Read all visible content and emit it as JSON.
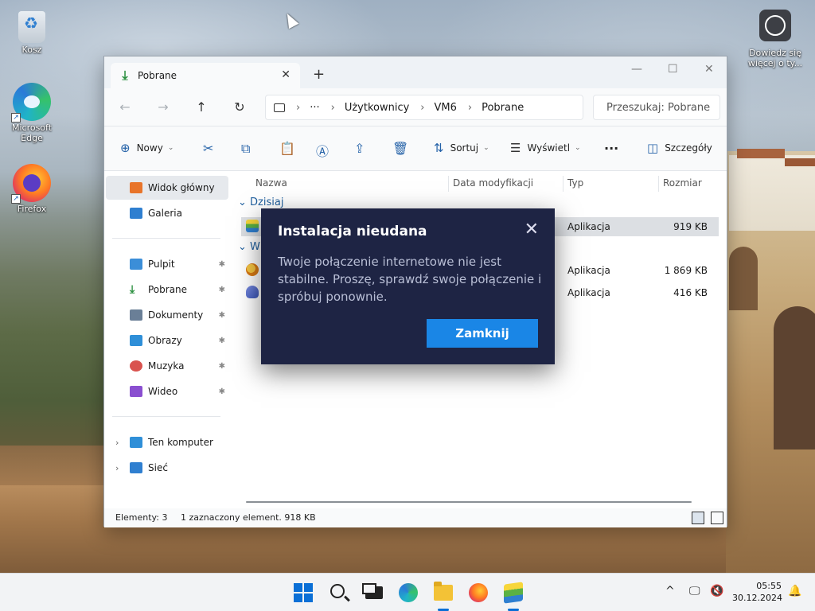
{
  "desktop": {
    "icons": [
      {
        "label": "Kosz",
        "icon": "recycle-bin-icon"
      },
      {
        "label": "Microsoft Edge",
        "icon": "edge-icon"
      },
      {
        "label": "Firefox",
        "icon": "firefox-icon"
      },
      {
        "label": "Dowiedz się więcej o ty...",
        "icon": "help-icon"
      }
    ]
  },
  "window": {
    "tab_title": "Pobrane",
    "new_tab": "+",
    "controls": {
      "minimize": "—",
      "maximize": "☐",
      "close": "✕"
    },
    "nav": {
      "back": "←",
      "forward": "→",
      "up": "↑",
      "refresh": "↻"
    },
    "path": {
      "more": "···",
      "segments": [
        "Użytkownicy",
        "VM6",
        "Pobrane"
      ],
      "sep": "›"
    },
    "search_placeholder": "Przeszukaj: Pobrane",
    "toolbar": {
      "new": "Nowy",
      "sort": "Sortuj",
      "view": "Wyświetl",
      "more": "···",
      "details": "Szczegóły"
    },
    "sidebar": {
      "items": [
        {
          "label": "Widok główny",
          "color": "#e8742a"
        },
        {
          "label": "Galeria",
          "color": "#2f7fd0"
        },
        {
          "label": "Pulpit",
          "color": "#3b8ed8"
        },
        {
          "label": "Pobrane",
          "color": "#2a8f3e"
        },
        {
          "label": "Dokumenty",
          "color": "#6a7f97"
        },
        {
          "label": "Obrazy",
          "color": "#2f8fd8"
        },
        {
          "label": "Muzyka",
          "color": "#d9534f"
        },
        {
          "label": "Wideo",
          "color": "#8a4fd0"
        },
        {
          "label": "Ten komputer",
          "color": "#2f8fd8"
        },
        {
          "label": "Sieć",
          "color": "#2f7fd0"
        }
      ],
      "pin": "📌"
    },
    "columns": {
      "name": "Nazwa",
      "date": "Data modyfikacji",
      "type": "Typ",
      "size": "Rozmiar"
    },
    "groups": {
      "today": "Dzisiaj",
      "earlier": "W"
    },
    "rows": [
      {
        "type": "Aplikacja",
        "size": "919 KB"
      },
      {
        "type": "Aplikacja",
        "size": "1 869 KB"
      },
      {
        "type": "Aplikacja",
        "size": "416 KB"
      }
    ],
    "status": {
      "count": "Elementy: 3",
      "selected": "1 zaznaczony element. 918 KB"
    }
  },
  "dialog": {
    "title": "Instalacja nieudana",
    "close": "✕",
    "message": "Twoje połączenie internetowe nie jest stabilne. Proszę, sprawdź swoje połączenie i spróbuj ponownie.",
    "button": "Zamknij"
  },
  "taskbar": {
    "time": "05:55",
    "date": "30.12.2024",
    "chevron": "^"
  }
}
